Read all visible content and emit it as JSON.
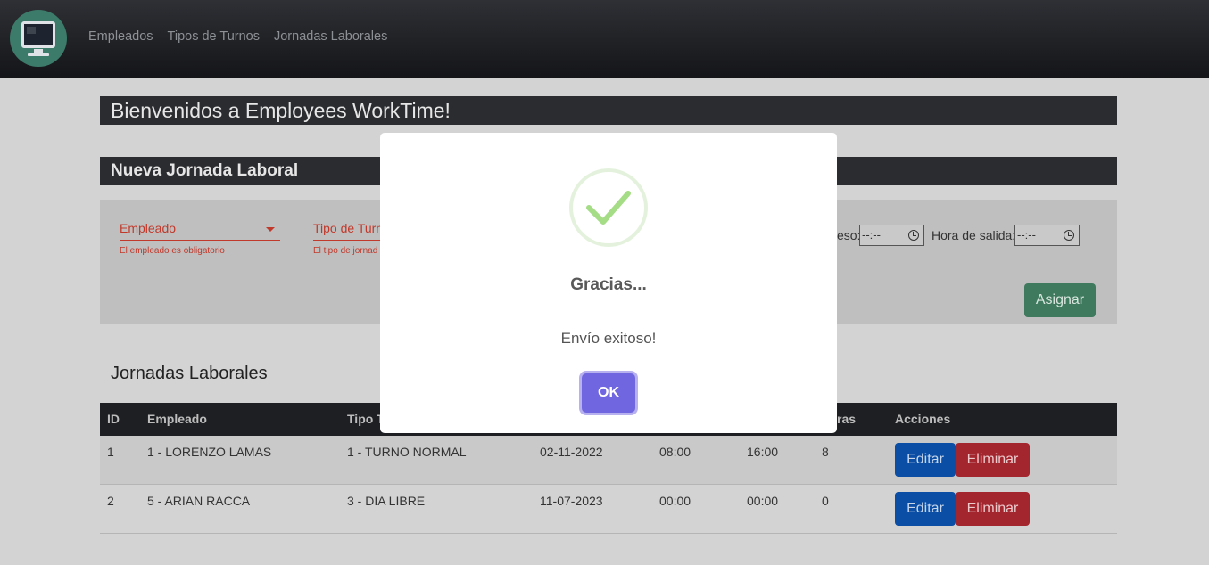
{
  "nav": {
    "links": [
      "Empleados",
      "Tipos de Turnos",
      "Jornadas Laborales"
    ]
  },
  "welcome": "Bienvenidos a Employees WorkTime!",
  "form": {
    "title": "Nueva Jornada Laboral",
    "empleado_label": "Empleado",
    "empleado_error": "El empleado es obligatorio",
    "turno_label": "Tipo de Turn",
    "turno_error": "El tipo de jornad",
    "ingreso_label": "eso:",
    "ingreso_value": "--:--",
    "salida_label": "Hora de salida:",
    "salida_value": "--:--",
    "asignar": "Asignar"
  },
  "table": {
    "title": "Jornadas Laborales",
    "headers": {
      "id": "ID",
      "empleado": "Empleado",
      "tipo": "Tipo T",
      "horas": "ras",
      "acciones": "Acciones"
    },
    "rows": [
      {
        "id": "1",
        "empleado": "1 - LORENZO LAMAS",
        "tipo": "1 - TURNO NORMAL",
        "fecha": "02-11-2022",
        "ingreso": "08:00",
        "salida": "16:00",
        "horas": "8",
        "edit": "Editar",
        "delete": "Eliminar"
      },
      {
        "id": "2",
        "empleado": "5 - ARIAN RACCA",
        "tipo": "3 - DIA LIBRE",
        "fecha": "11-07-2023",
        "ingreso": "00:00",
        "salida": "00:00",
        "horas": "0",
        "edit": "Editar",
        "delete": "Eliminar"
      }
    ]
  },
  "modal": {
    "title": "Gracias...",
    "text": "Envío exitoso!",
    "ok": "OK",
    "icon": "success-check-icon",
    "accent": "#7066e0",
    "check_color": "#a5dc86"
  }
}
